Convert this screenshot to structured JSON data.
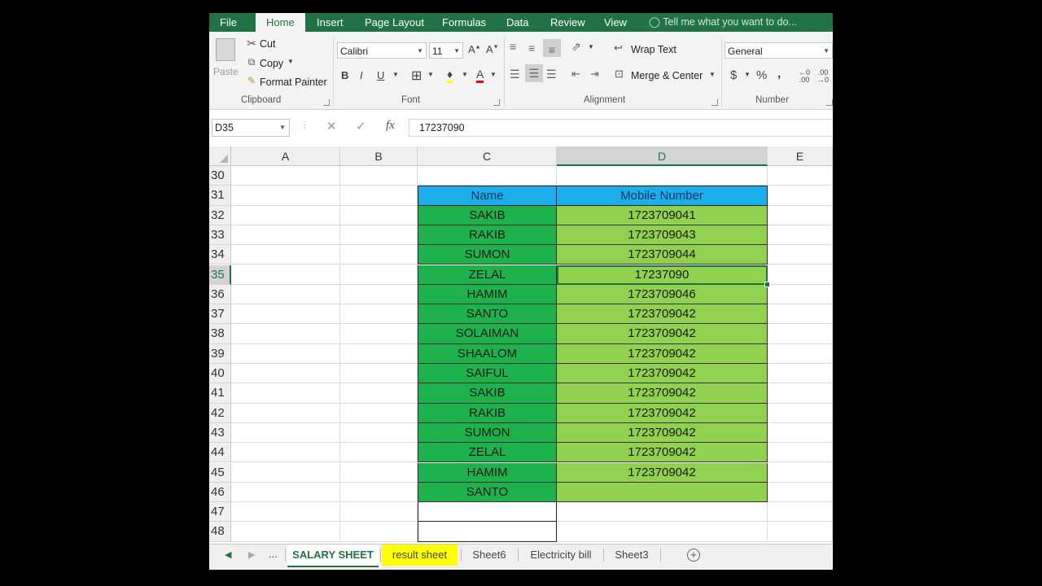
{
  "ribbon_tabs": [
    "File",
    "Home",
    "Insert",
    "Page Layout",
    "Formulas",
    "Data",
    "Review",
    "View"
  ],
  "tell_me": "Tell me what you want to do...",
  "clipboard": {
    "paste": "Paste",
    "cut": "Cut",
    "copy": "Copy",
    "format_painter": "Format Painter",
    "label": "Clipboard"
  },
  "font": {
    "name": "Calibri",
    "size": "11",
    "label": "Font"
  },
  "alignment": {
    "wrap_text": "Wrap Text",
    "merge_center": "Merge & Center",
    "label": "Alignment"
  },
  "number": {
    "format": "General",
    "label": "Number",
    "currency": "$",
    "percent": "%",
    "comma": ","
  },
  "formula_bar": {
    "name_box": "D35",
    "value": "17237090"
  },
  "columns": [
    "A",
    "B",
    "C",
    "D",
    "E"
  ],
  "rows": [
    "30",
    "31",
    "32",
    "33",
    "34",
    "35",
    "36",
    "37",
    "38",
    "39",
    "40",
    "41",
    "42",
    "43",
    "44",
    "45",
    "46",
    "47",
    "48"
  ],
  "table": {
    "headers": [
      "Name",
      "Mobile Number"
    ],
    "names": [
      "SAKIB",
      "RAKIB",
      "SUMON",
      "ZELAL",
      "HAMIM",
      "SANTO",
      "SOLAIMAN",
      "SHAALOM",
      "SAIFUL",
      "SAKIB",
      "RAKIB",
      "SUMON",
      "ZELAL",
      "HAMIM",
      "SANTO"
    ],
    "numbers": [
      "1723709041",
      "1723709043",
      "1723709044",
      "17237090",
      "1723709046",
      "1723709042",
      "1723709042",
      "1723709042",
      "1723709042",
      "1723709042",
      "1723709042",
      "1723709042",
      "1723709042",
      "1723709042",
      ""
    ]
  },
  "active_cell": "D35",
  "sheets": [
    {
      "label": "SALARY SHEET",
      "state": "active"
    },
    {
      "label": "result sheet",
      "state": "yellow"
    },
    {
      "label": "Sheet6",
      "state": "normal"
    },
    {
      "label": "Electricity bill",
      "state": "normal"
    },
    {
      "label": "Sheet3",
      "state": "normal"
    }
  ],
  "sheet_nav_more": "...",
  "colors": {
    "excel_green": "#217346",
    "header_blue": "#1cadeb",
    "name_green": "#1fb14c",
    "number_green": "#92d050",
    "result_tab": "#ffff00"
  }
}
